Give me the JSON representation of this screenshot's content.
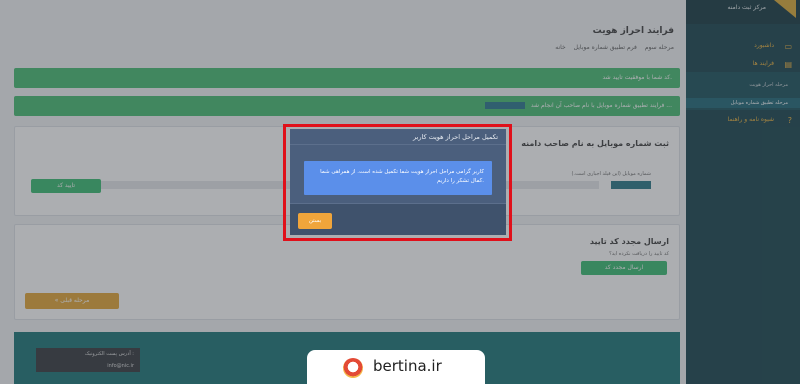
{
  "page": {
    "title": "فرایند احراز هویت",
    "breadcrumb": [
      "خانه",
      "فرم تطبیق شماره موبایل",
      "مرحله سوم"
    ]
  },
  "alerts": [
    {
      "text": "کد شما با موفقیت تایید شد."
    },
    {
      "text": "فرایند تطبیق شماره موبایل با نام صاحب آن انجام شد ..."
    }
  ],
  "card_mobile": {
    "title": "ثبت شماره موبایل به نام صاحب دامنه",
    "field_label": "شماره موبایل (این فیلد اجباری است.)",
    "confirm_button": "تایید کد"
  },
  "card_resend": {
    "title": "ارسال مجدد کد تایید",
    "sub_label": "کد تایید را دریافت نکرده اید؟",
    "resend_button": "ارسال مجدد کد",
    "prev_button": "« مرحله قبلی"
  },
  "footer": {
    "box_lines": [
      "آدرس پست الکترونیک :",
      "info@nic.ir"
    ]
  },
  "sidebar": {
    "logo_text": "مرکز ثبت دامنه",
    "items": [
      {
        "label": "داشبورد",
        "icon": "monitor-icon"
      },
      {
        "label": "فرایند ها",
        "icon": "document-icon"
      },
      {
        "label": "شیوه نامه و راهنما",
        "icon": "help-icon"
      }
    ],
    "sub_items": [
      {
        "label": "مرحله احراز هویت"
      },
      {
        "label": "مرحله تطبیق شماره موبایل"
      }
    ]
  },
  "modal": {
    "title": "تکمیل مراحل احراز هویت کاربر",
    "message": "کاربر گرامی مراحل احراز هویت شما تکمیل شده است. از همراهی شما کمال تشکر را داریم.",
    "close_button": "بستن"
  },
  "watermark": {
    "text": "bertina.ir"
  },
  "colors": {
    "highlight": "#e0101a",
    "modal_bg": "#4b5f7d",
    "message_bg": "#5b8fea",
    "close_button": "#f0a53b",
    "alert_green": "#3cb86a",
    "sidebar_bg": "#0b3a44"
  }
}
